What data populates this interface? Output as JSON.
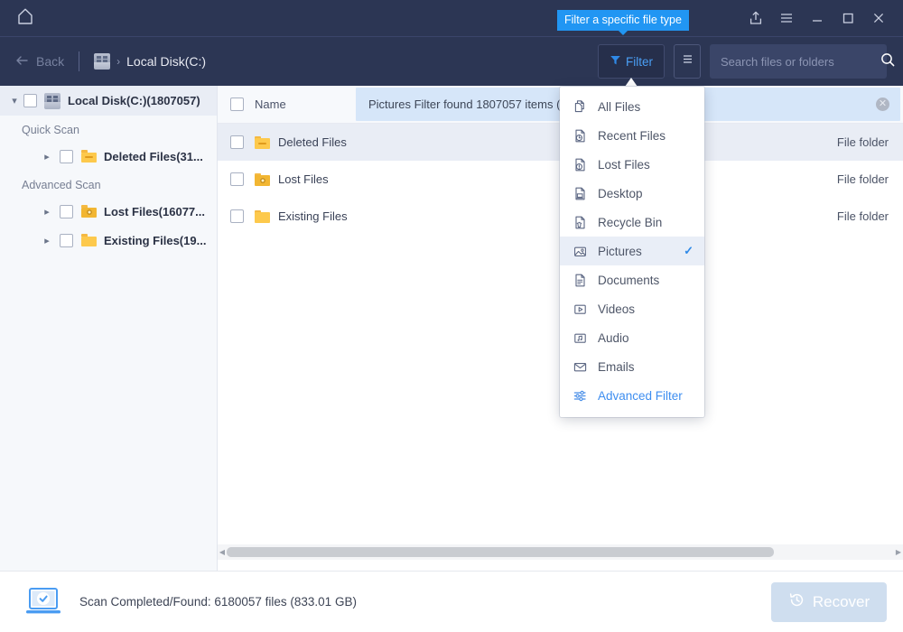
{
  "titlebar": {
    "home_icon": "home-icon",
    "tooltip": "Filter a specific file type",
    "icons": [
      {
        "name": "share-export-icon",
        "glyph": "share"
      },
      {
        "name": "hamburger-menu-icon",
        "glyph": "menu"
      },
      {
        "name": "minimize-icon",
        "glyph": "minimize"
      },
      {
        "name": "maximize-icon",
        "glyph": "maximize"
      },
      {
        "name": "close-icon",
        "glyph": "close"
      }
    ]
  },
  "navbar": {
    "back_label": "Back",
    "crumb_separator": "›",
    "crumb_label": "Local Disk(C:)",
    "filter_label": "Filter",
    "search_placeholder": "Search files or folders",
    "search_value": ""
  },
  "sidebar": {
    "root": {
      "label": "Local Disk(C:)(1807057)",
      "expanded": true
    },
    "groups": [
      {
        "label": "Quick Scan",
        "items": [
          {
            "label": "Deleted Files(31...",
            "icon": "folder-deleted-icon"
          }
        ]
      },
      {
        "label": "Advanced Scan",
        "items": [
          {
            "label": "Lost Files(16077...",
            "icon": "folder-lost-icon"
          },
          {
            "label": "Existing Files(19...",
            "icon": "folder-icon"
          }
        ]
      }
    ]
  },
  "content": {
    "column_header": "Name",
    "banner": {
      "text": "Pictures Filter found 1807057 items (1807057/0000)",
      "close_label": "✕"
    },
    "rows": [
      {
        "name": "Deleted Files",
        "type": "File folder",
        "icon": "folder-deleted-icon",
        "selected": true
      },
      {
        "name": "Lost Files",
        "type": "File folder",
        "icon": "folder-lost-icon",
        "selected": false
      },
      {
        "name": "Existing Files",
        "type": "File folder",
        "icon": "folder-icon",
        "selected": false
      }
    ]
  },
  "dropdown": {
    "items": [
      {
        "label": "All Files",
        "icon": "copy-files-icon",
        "checked": false,
        "accent": false
      },
      {
        "label": "Recent Files",
        "icon": "file-clock-icon",
        "checked": false,
        "accent": false
      },
      {
        "label": "Lost Files",
        "icon": "file-alert-icon",
        "checked": false,
        "accent": false
      },
      {
        "label": "Desktop",
        "icon": "file-desktop-icon",
        "checked": false,
        "accent": false
      },
      {
        "label": "Recycle Bin",
        "icon": "file-trash-icon",
        "checked": false,
        "accent": false
      },
      {
        "label": "Pictures",
        "icon": "image-icon",
        "checked": true,
        "accent": false
      },
      {
        "label": "Documents",
        "icon": "document-icon",
        "checked": false,
        "accent": false
      },
      {
        "label": "Videos",
        "icon": "video-icon",
        "checked": false,
        "accent": false
      },
      {
        "label": "Audio",
        "icon": "audio-icon",
        "checked": false,
        "accent": false
      },
      {
        "label": "Emails",
        "icon": "mail-icon",
        "checked": false,
        "accent": false
      },
      {
        "label": "Advanced Filter",
        "icon": "sliders-icon",
        "checked": false,
        "accent": true
      }
    ],
    "check_glyph": "✓"
  },
  "footer": {
    "status": "Scan Completed/Found: 6180057 files (833.01 GB)",
    "recover_label": "Recover"
  },
  "colors": {
    "titlebar_bg": "#2c3654",
    "accent_blue": "#2196f3",
    "link_blue": "#3e8ef0",
    "banner_bg": "#d6e6f9",
    "sidebar_bg": "#f6f8fb",
    "selected_row": "#e9edf5",
    "folder_yellow": "#fdc94c"
  }
}
